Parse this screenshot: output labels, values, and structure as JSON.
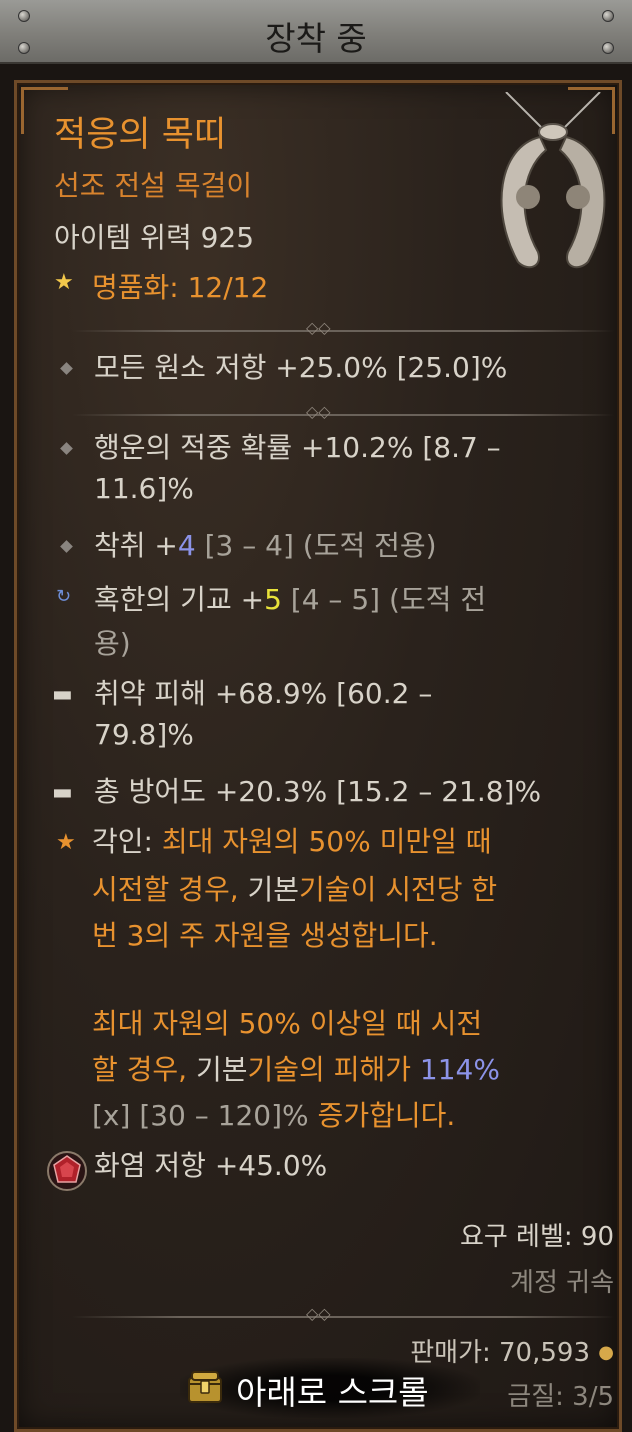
{
  "header": {
    "title": "장착 중"
  },
  "item": {
    "name": "적응의 목띠",
    "type": "선조 전설 목걸이",
    "power": "아이템 위력 925",
    "masterwork_label": "명품화: 12/12"
  },
  "stats": {
    "implicit": "모든 원소 저항 +25.0% [25.0]%",
    "s1_line1": "행운의 적중 확률 +10.2% [8.7 –",
    "s1_line2": "11.6]%",
    "s2_prefix": "착취 +",
    "s2_value": "4",
    "s2_suffix": " [3 – 4] (도적 전용)",
    "s3_prefix": "혹한의 기교 +",
    "s3_value": "5",
    "s3_suffix": " [4 – 5] (도적 전",
    "s3_line2": "용)",
    "s4_line1": "취약 피해 +68.9% [60.2 –",
    "s4_line2": "79.8]%",
    "s5": "총 방어도 +20.3% [15.2 – 21.8]%"
  },
  "aspect": {
    "label": "각인:",
    "l1": " 최대 자원의 50% 미만일 때",
    "l2a": "시전할 경우, ",
    "l2b": "기본",
    "l2c": "기술이 시전당 한",
    "l3": "번 3의 주 자원을 생성합니다.",
    "l4": "최대 자원의 50% 이상일 때 시전",
    "l5a": "할 경우, ",
    "l5b": "기본",
    "l5c": "기술의 피해가 ",
    "l5d": "114%",
    "l6a": "[x] [30 – 120]%",
    "l6b": " 증가합니다."
  },
  "socket": {
    "text": "화염 저항 +45.0%"
  },
  "footer": {
    "required_level": "요구 레벨: 90",
    "bound": "계정 귀속",
    "sell_price": "판매가: 70,593",
    "quality": "금질: 3/5",
    "scroll_hint": "아래로 스크롤"
  },
  "colors": {
    "legendary": "#e8922f",
    "stat_text": "#d8d3c9",
    "greater_affix_blue": "#8c93e8",
    "skill_rank_yellow": "#e8e23a"
  }
}
